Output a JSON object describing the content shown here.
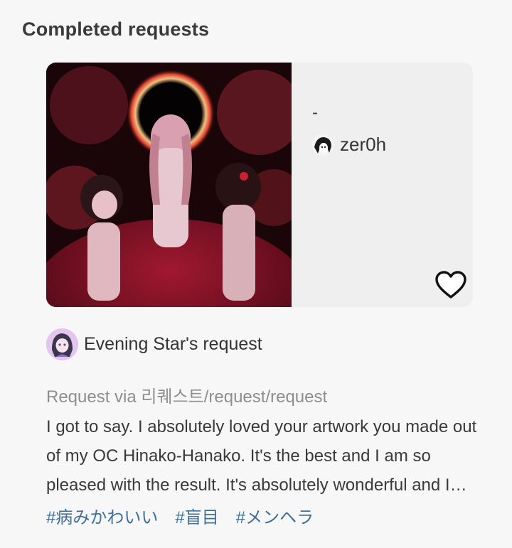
{
  "section": {
    "title": "Completed requests"
  },
  "artwork_card": {
    "title": "-",
    "artist_name": "zer0h",
    "liked": false
  },
  "request": {
    "requester_label": "Evening Star's request",
    "via": "Request via 리퀘스트/request/request",
    "message": "I got to say. I absolutely loved your artwork you made out of my OC Hinako-Hanako. It's the best and I am so pleased with the result. It's absolutely wonderful and I love it so much.",
    "tags": [
      "#病みかわいい",
      "#盲目",
      "#メンヘラ"
    ]
  },
  "colors": {
    "background": "#f7f7f7",
    "card": "#efefef",
    "tag": "#3f6f9a",
    "muted": "#8e8e8e"
  }
}
